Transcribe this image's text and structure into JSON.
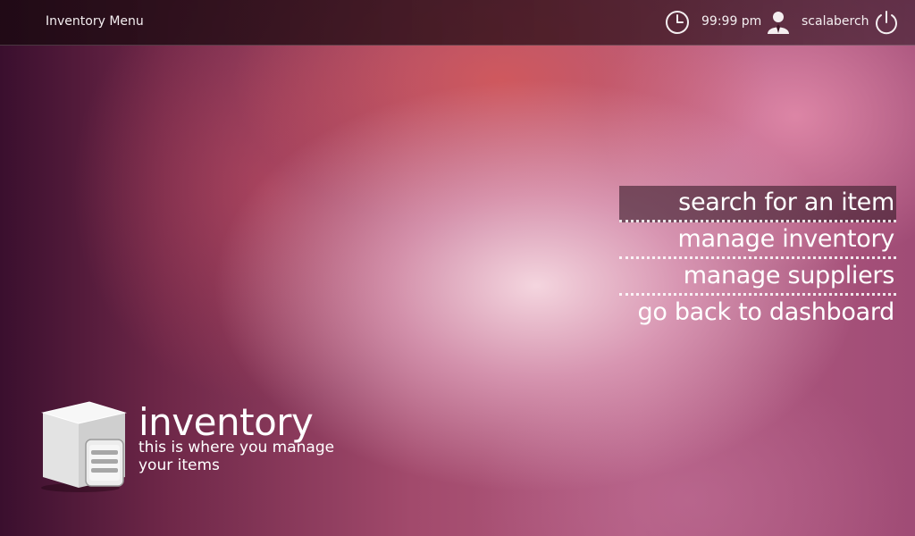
{
  "topbar": {
    "title": "Inventory Menu",
    "clock_icon": "clock-icon",
    "time": "99:99 pm",
    "user_icon": "user-icon",
    "username": "scalaberch",
    "power_icon": "power-icon"
  },
  "menu": {
    "items": [
      {
        "label": "search for an item",
        "selected": true
      },
      {
        "label": "manage inventory",
        "selected": false
      },
      {
        "label": "manage suppliers",
        "selected": false
      },
      {
        "label": "go back to dashboard",
        "selected": false
      }
    ]
  },
  "module": {
    "icon": "inventory-box-icon",
    "title": "inventory",
    "description": "this is where you manage your items"
  },
  "colors": {
    "accent_selected": "#3c1e2d",
    "text": "#ffffff",
    "topbar_bg": "#1e0a14"
  }
}
